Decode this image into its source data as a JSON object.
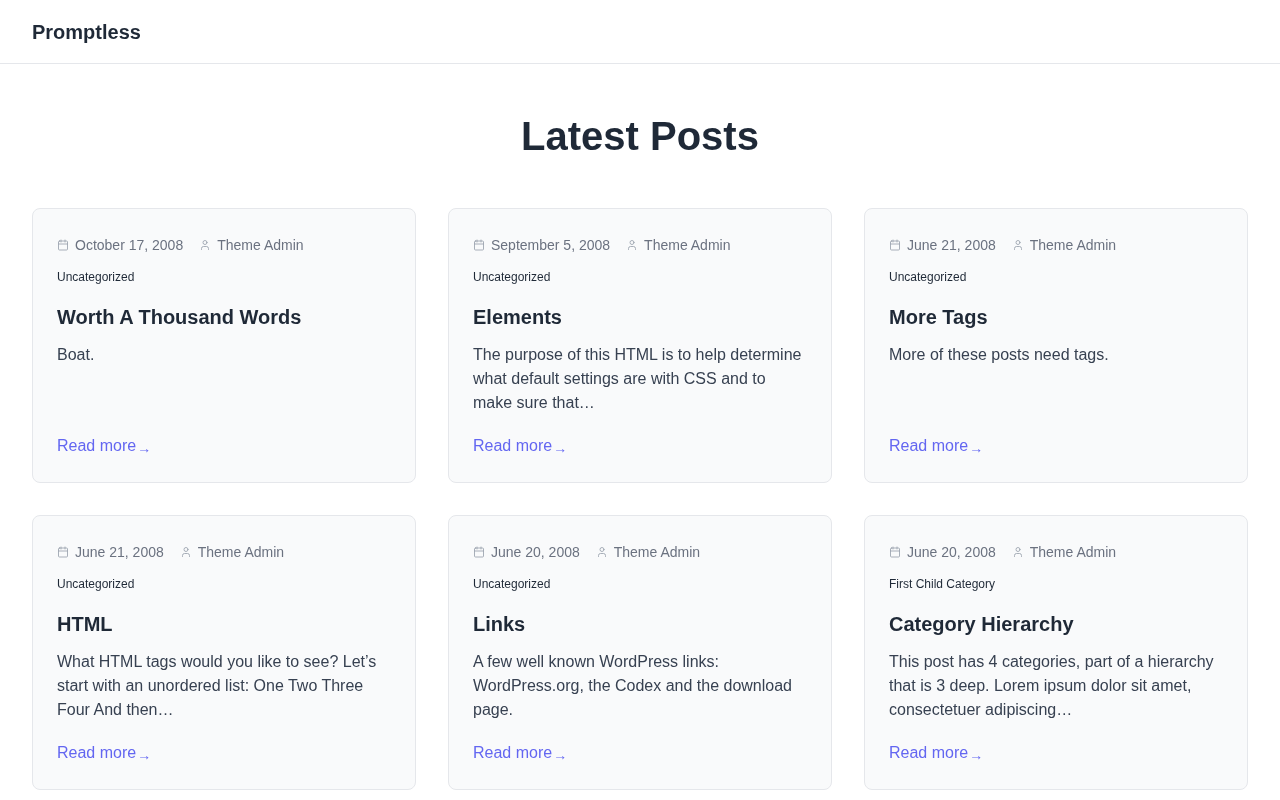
{
  "header": {
    "site_title": "Promptless"
  },
  "page_title": "Latest Posts",
  "posts": [
    {
      "date": "October 17, 2008",
      "author": "Theme Admin",
      "category": "Uncategorized",
      "title": "Worth A Thousand Words",
      "excerpt": "Boat.",
      "read_more": {
        "label": "Read more",
        "arrow": "→"
      }
    },
    {
      "date": "September 5, 2008",
      "author": "Theme Admin",
      "category": "Uncategorized",
      "title": "Elements",
      "excerpt": "The purpose of this HTML is to help determine what default settings are with CSS and to make sure that…",
      "read_more": {
        "label": "Read more",
        "arrow": "→"
      }
    },
    {
      "date": "June 21, 2008",
      "author": "Theme Admin",
      "category": "Uncategorized",
      "title": "More Tags",
      "excerpt": "More of these posts need tags.",
      "read_more": {
        "label": "Read more",
        "arrow": "→"
      }
    },
    {
      "date": "June 21, 2008",
      "author": "Theme Admin",
      "category": "Uncategorized",
      "title": "HTML",
      "excerpt": "What HTML tags would you like to see? Let’s start with an unordered list: One Two Three Four And then…",
      "read_more": {
        "label": "Read more",
        "arrow": "→"
      }
    },
    {
      "date": "June 20, 2008",
      "author": "Theme Admin",
      "category": "Uncategorized",
      "title": "Links",
      "excerpt": "A few well known WordPress links: WordPress.org, the Codex and the download page.",
      "read_more": {
        "label": "Read more",
        "arrow": "→"
      }
    },
    {
      "date": "June 20, 2008",
      "author": "Theme Admin",
      "category": "First Child Category",
      "title": "Category Hierarchy",
      "excerpt": "This post has 4 categories, part of a hierarchy that is 3 deep. Lorem ipsum dolor sit amet, consectetuer adipiscing…",
      "read_more": {
        "label": "Read more",
        "arrow": "→"
      }
    }
  ]
}
